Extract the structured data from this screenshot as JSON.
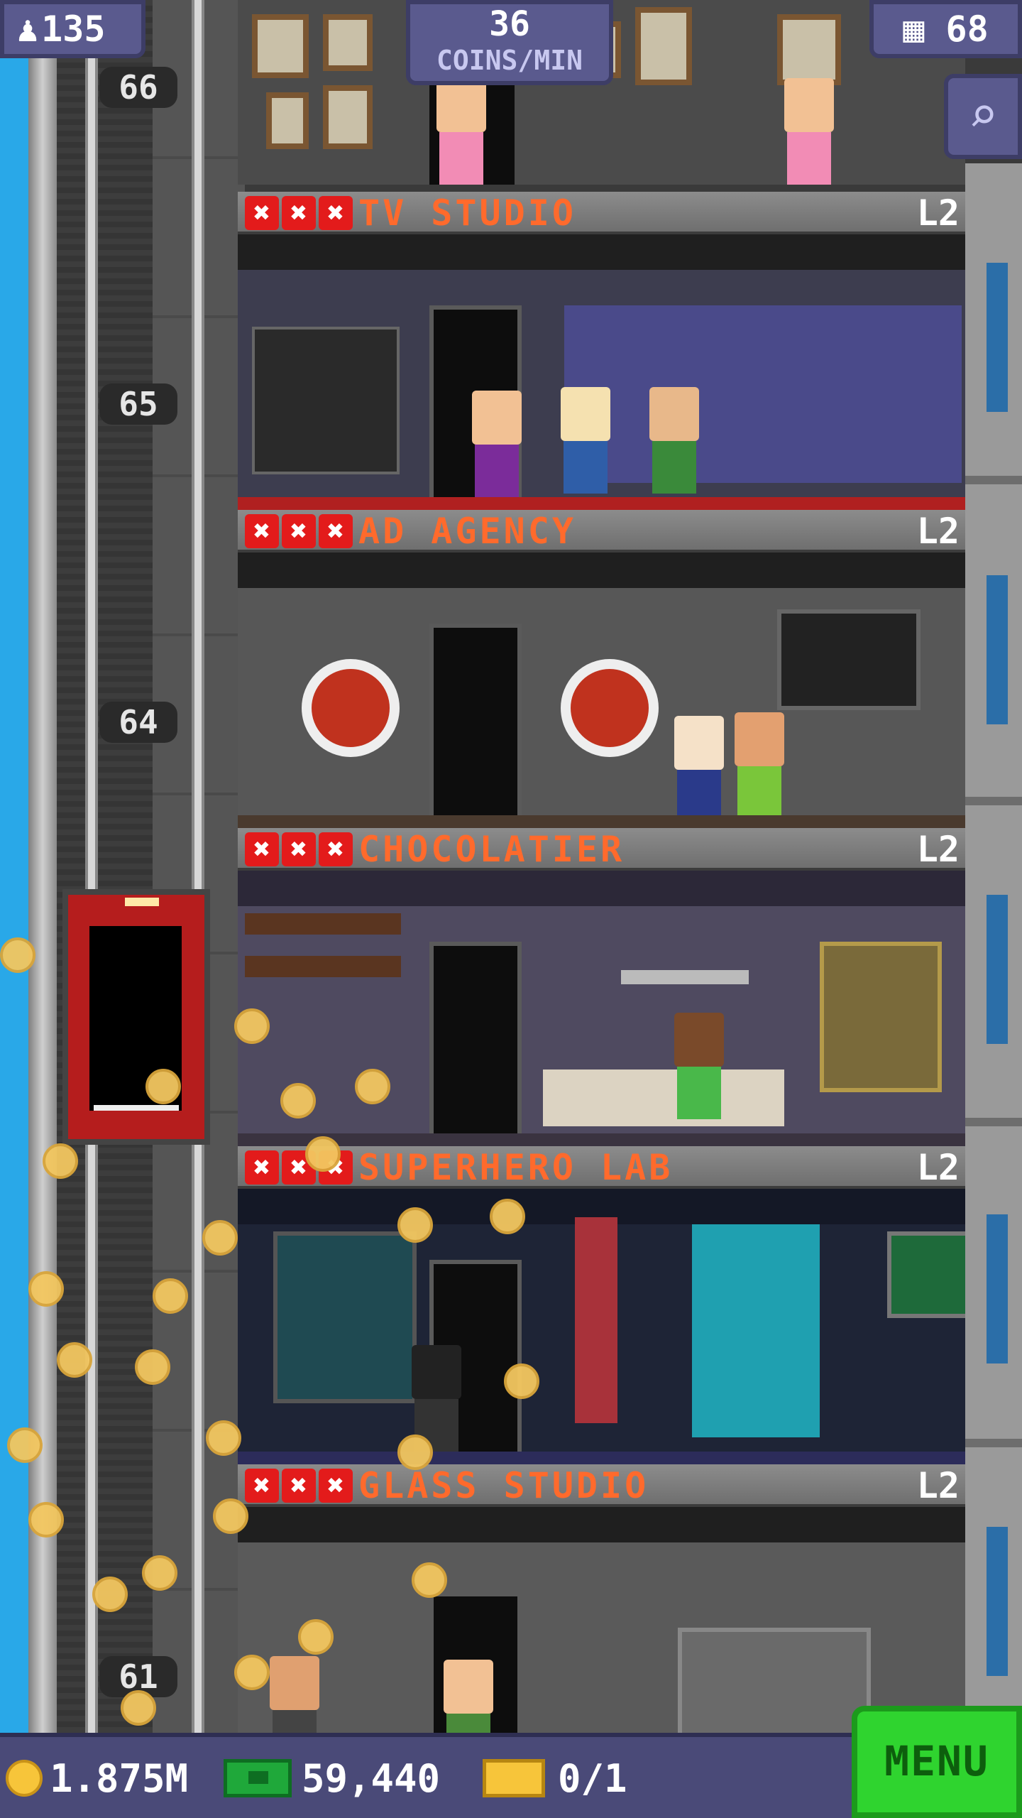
{
  "hud": {
    "population": "135",
    "coins_per_min_value": "36",
    "coins_per_min_label": "COINS/MIN",
    "floors_count": "68"
  },
  "shaft": {
    "floor_numbers": [
      "66",
      "65",
      "64",
      "61"
    ]
  },
  "floors": [
    {
      "name": "TV STUDIO",
      "level": "L2",
      "stars": [
        "✖",
        "✖",
        "✖"
      ]
    },
    {
      "name": "AD AGENCY",
      "level": "L2",
      "stars": [
        "✖",
        "✖",
        "✖"
      ]
    },
    {
      "name": "CHOCOLATIER",
      "level": "L2",
      "stars": [
        "✖",
        "✖",
        "✖"
      ]
    },
    {
      "name": "SUPERHERO LAB",
      "level": "L2",
      "stars": [
        "✖",
        "✖",
        "✖"
      ]
    },
    {
      "name": "GLASS STUDIO",
      "level": "L2",
      "stars": [
        "✖",
        "✖",
        "✖"
      ]
    }
  ],
  "bottom_bar": {
    "coins": "1.875M",
    "bux": "59,440",
    "tickets": "0/1",
    "menu_label": "MENU"
  },
  "icons": {
    "population": "person-icon",
    "floors": "building-icon",
    "search": "magnifier-icon"
  },
  "colors": {
    "sky": "#29a8e8",
    "hud_bg": "#5a5a8e",
    "floor_name": "#ff6a2c",
    "star_fail": "#e31b1b",
    "menu": "#2fd42f"
  }
}
